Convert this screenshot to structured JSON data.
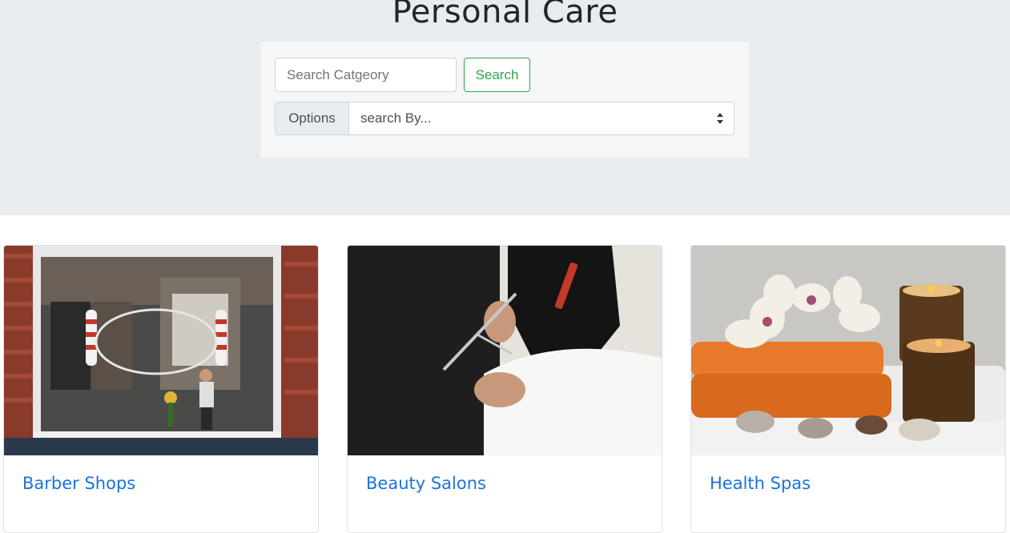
{
  "header": {
    "title": "Personal Care"
  },
  "search": {
    "placeholder": "Search Catgeory",
    "button_label": "Search",
    "options_label": "Options",
    "select_value": "search By..."
  },
  "cards": [
    {
      "title": "Barber Shops",
      "image": "barber-shop-storefront-photo"
    },
    {
      "title": "Beauty Salons",
      "image": "hair-cutting-photo"
    },
    {
      "title": "Health Spas",
      "image": "spa-towels-orchid-candles-photo"
    }
  ],
  "colors": {
    "hero_bg": "#e9ecef",
    "accent_green": "#28a745",
    "link_blue": "#1a73d9"
  }
}
